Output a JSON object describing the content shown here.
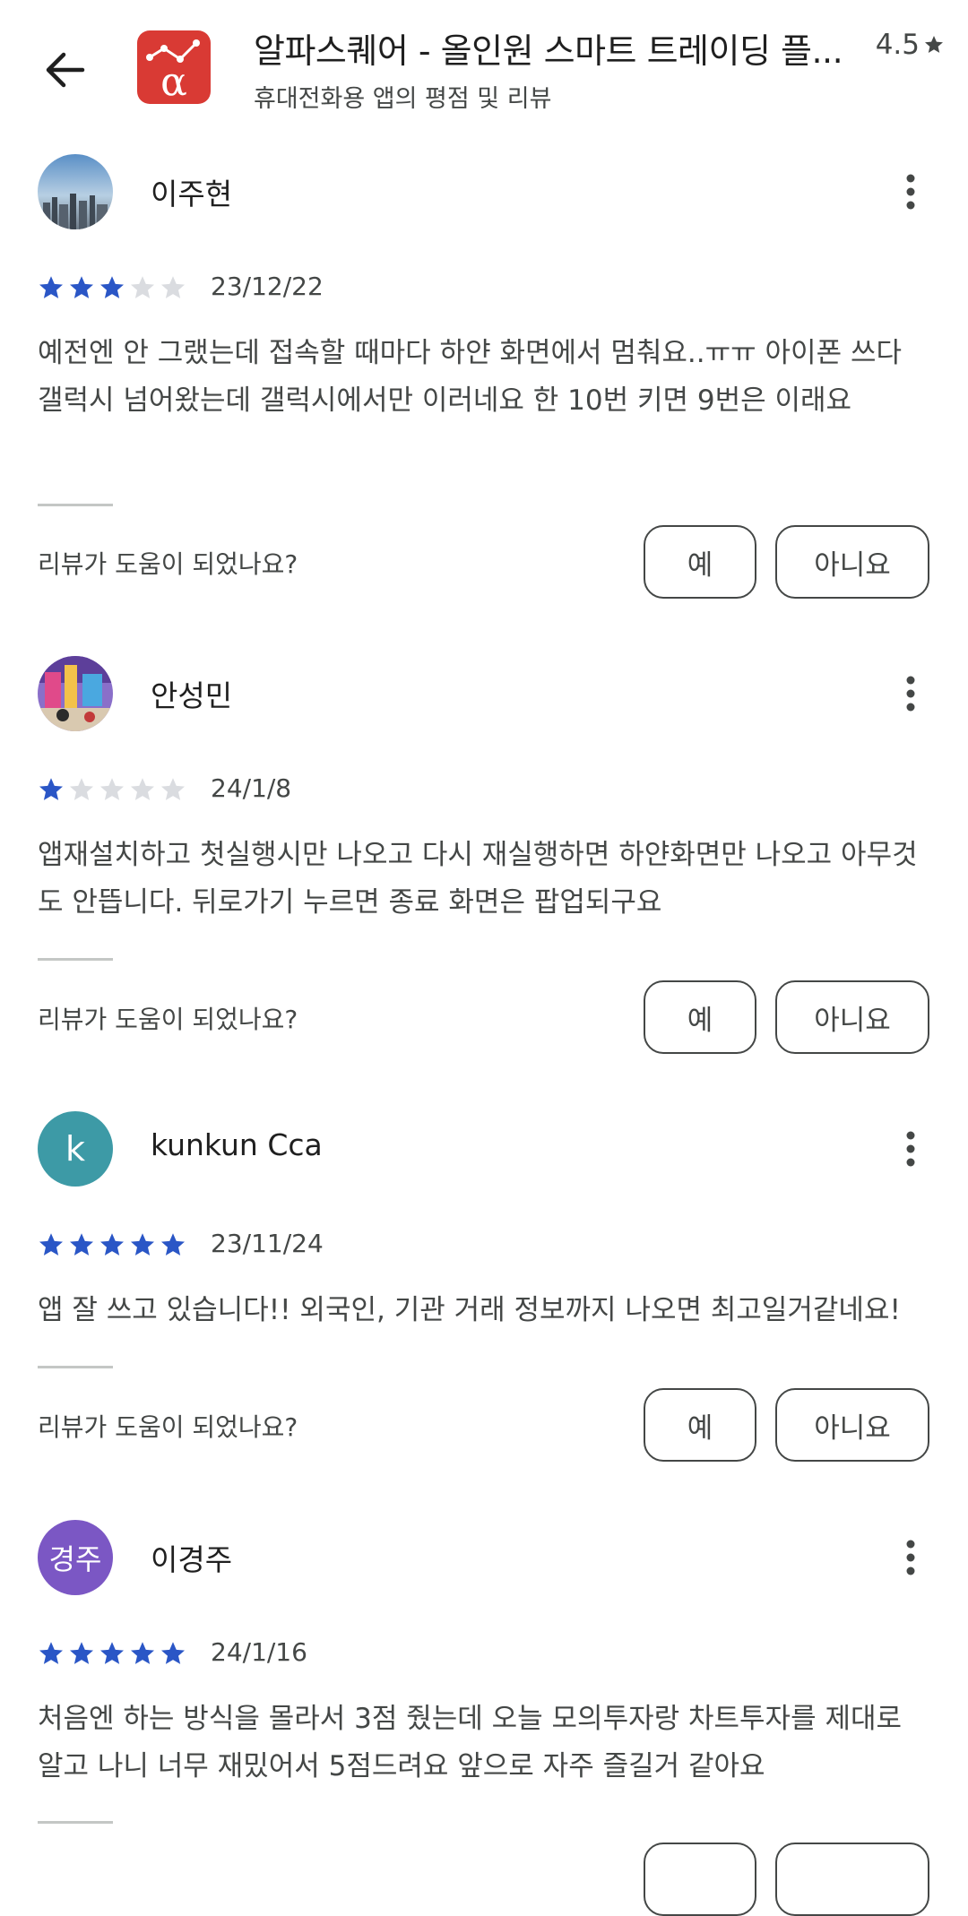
{
  "header": {
    "title": "알파스퀘어 - 올인원 스마트 트레이딩 플...",
    "subtitle": "휴대전화용 앱의 평점 및 리뷰",
    "rating": "4.5",
    "icon_glyph": "α",
    "brand_color": "#d93a34"
  },
  "star_colors": {
    "filled": "#2a56c6",
    "empty": "#dadce0"
  },
  "helpful": {
    "question": "리뷰가 도움이 되었나요?",
    "yes": "예",
    "no": "아니요"
  },
  "reviews": [
    {
      "author": "이주현",
      "avatar": "photo-sky",
      "stars": 3,
      "date": "23/12/22",
      "body": "예전엔 안 그랬는데 접속할 때마다 하얀 화면에서 멈춰요..ㅠㅠ 아이폰 쓰다 갤럭시 넘어왔는데 갤럭시에서만 이러네요 한 10번 키면 9번은 이래요"
    },
    {
      "author": "안성민",
      "avatar": "photo-city",
      "stars": 1,
      "date": "24/1/8",
      "body": "앱재설치하고 첫실행시만 나오고 다시 재실행하면 하얀화면만 나오고 아무것도 안뜹니다. 뒤로가기 누르면 종료 화면은 팝업되구요"
    },
    {
      "author": "kunkun Cca",
      "avatar_letter": "k",
      "avatar_color": "#3d9aa6",
      "stars": 5,
      "date": "23/11/24",
      "body": "앱 잘 쓰고 있습니다!! 외국인, 기관 거래 정보까지 나오면 최고일거같네요!"
    },
    {
      "author": "이경주",
      "avatar_letter": "경주",
      "avatar_color": "#7b57c4",
      "stars": 5,
      "date": "24/1/16",
      "body": "처음엔 하는 방식을 몰라서 3점 줬는데 오늘 모의투자랑 차트투자를 제대로 알고 나니 너무 재밌어서 5점드려요 앞으로 자주 즐길거 같아요"
    }
  ]
}
